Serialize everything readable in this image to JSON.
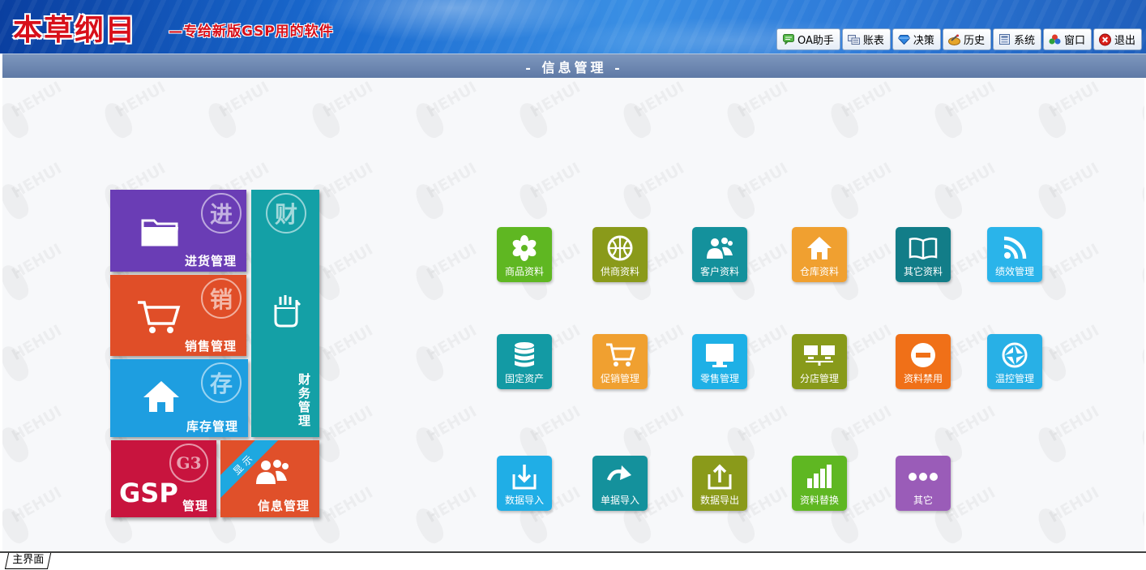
{
  "header": {
    "logo_main": "本草纲目",
    "logo_sub": "—专给新版GSP用的软件"
  },
  "toolbar": [
    {
      "label": "OA助手",
      "icon": "chat-icon",
      "color": "#3fa33b"
    },
    {
      "label": "账表",
      "icon": "ledger-icon",
      "color": "#5a6f9a"
    },
    {
      "label": "决策",
      "icon": "diamond-icon",
      "color": "#1e6fd1"
    },
    {
      "label": "历史",
      "icon": "history-icon",
      "color": "#d89020"
    },
    {
      "label": "系统",
      "icon": "system-icon",
      "color": "#4a6aa0"
    },
    {
      "label": "窗口",
      "icon": "window-icon",
      "color": "#d23a2a"
    },
    {
      "label": "退出",
      "icon": "exit-icon",
      "color": "#d21a1a"
    }
  ],
  "title_strip": "- 信息管理 -",
  "left_tiles": {
    "purchase": {
      "label": "进货管理",
      "badge": "进",
      "icon": "folder-icon",
      "color": "#6a3db5"
    },
    "sales": {
      "label": "销售管理",
      "badge": "销",
      "icon": "cart-icon",
      "color": "#e04e28"
    },
    "inventory": {
      "label": "库存管理",
      "badge": "存",
      "icon": "home-icon",
      "color": "#1e9ee0"
    },
    "finance": {
      "label": "财务管理",
      "badge": "财",
      "icon": "hand-icon",
      "color": "#14a0a6"
    },
    "gsp": {
      "label": "管理",
      "logo": "GSP",
      "badge": "G3",
      "color": "#c8143e"
    },
    "info": {
      "label": "信息管理",
      "ribbon": "显 示",
      "icon": "users-icon",
      "color": "#e0502a"
    }
  },
  "icons": [
    {
      "label": "商品资料",
      "icon": "flower-icon",
      "color": "#5fb722"
    },
    {
      "label": "供商资料",
      "icon": "basketball-icon",
      "color": "#8a9a1a"
    },
    {
      "label": "客户资料",
      "icon": "people-icon",
      "color": "#14919c"
    },
    {
      "label": "仓库资料",
      "icon": "house-icon",
      "color": "#f0a030"
    },
    {
      "label": "其它资料",
      "icon": "book-icon",
      "color": "#127d88"
    },
    {
      "label": "绩效管理",
      "icon": "rss-icon",
      "color": "#2ab4ea"
    },
    {
      "label": "固定资产",
      "icon": "database-icon",
      "color": "#139aa4"
    },
    {
      "label": "促销管理",
      "icon": "cart-icon",
      "color": "#f0a030"
    },
    {
      "label": "零售管理",
      "icon": "monitor-icon",
      "color": "#1eb0e6"
    },
    {
      "label": "分店管理",
      "icon": "network-icon",
      "color": "#889a1a"
    },
    {
      "label": "资料禁用",
      "icon": "forbid-icon",
      "color": "#f07018"
    },
    {
      "label": "温控管理",
      "icon": "camera-icon",
      "color": "#28b0e6"
    },
    {
      "label": "数据导入",
      "icon": "import-icon",
      "color": "#20aee6"
    },
    {
      "label": "单据导入",
      "icon": "redo-icon",
      "color": "#14919c"
    },
    {
      "label": "数据导出",
      "icon": "export-icon",
      "color": "#8a9a1a"
    },
    {
      "label": "资料替换",
      "icon": "barchart-icon",
      "color": "#5fb722"
    },
    {
      "label": "其它",
      "icon": "more-icon",
      "color": "#9a5cb8"
    }
  ],
  "watermark": "HEHUI",
  "bottom_tab": "主界面"
}
